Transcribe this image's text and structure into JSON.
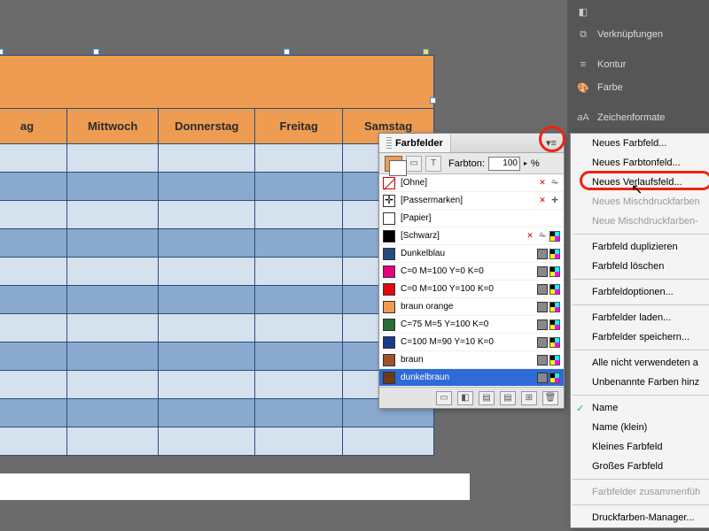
{
  "calendar": {
    "days": [
      "ag",
      "Mittwoch",
      "Donnerstag",
      "Freitag",
      "Samstag"
    ]
  },
  "side_panels": {
    "items": [
      {
        "icon": "layers",
        "label": ""
      },
      {
        "icon": "links",
        "label": "Verknüpfungen"
      },
      {
        "icon": "stroke",
        "label": "Kontur"
      },
      {
        "icon": "color",
        "label": "Farbe"
      },
      {
        "icon": "charstyle",
        "label": "Zeichenformate"
      }
    ]
  },
  "swatches_panel": {
    "title": "Farbfelder",
    "tint_label": "Farbton:",
    "tint_value": "100",
    "tint_unit": "%",
    "rows": [
      {
        "chip": "none",
        "name": "[Ohne]",
        "icons": [
          "x",
          "lock"
        ]
      },
      {
        "chip": "reg",
        "name": "[Passermarken]",
        "icons": [
          "x",
          "reg"
        ]
      },
      {
        "chip": "#ffffff",
        "name": "[Papier]",
        "icons": []
      },
      {
        "chip": "#000000",
        "name": "[Schwarz]",
        "icons": [
          "x",
          "lock",
          "cmyk"
        ]
      },
      {
        "chip": "#284b7e",
        "name": "Dunkelblau",
        "icons": [
          "gray",
          "cmyk"
        ]
      },
      {
        "chip": "#e6007e",
        "name": "C=0 M=100 Y=0 K=0",
        "icons": [
          "gray",
          "cmyk"
        ]
      },
      {
        "chip": "#e30613",
        "name": "C=0 M=100 Y=100 K=0",
        "icons": [
          "gray",
          "cmyk"
        ]
      },
      {
        "chip": "#ed9c52",
        "name": "braun orange",
        "icons": [
          "gray",
          "cmyk"
        ]
      },
      {
        "chip": "#2a6c3a",
        "name": "C=75 M=5 Y=100 K=0",
        "icons": [
          "gray",
          "cmyk"
        ]
      },
      {
        "chip": "#1b3a8a",
        "name": "C=100 M=90 Y=10 K=0",
        "icons": [
          "gray",
          "cmyk"
        ]
      },
      {
        "chip": "#a0522d",
        "name": "braun",
        "icons": [
          "gray",
          "cmyk"
        ]
      },
      {
        "chip": "#6b3a18",
        "name": "dunkelbraun",
        "icons": [
          "gray",
          "cmyk"
        ],
        "selected": true
      }
    ]
  },
  "flyout": {
    "items": [
      {
        "label": "Neues Farbfeld..."
      },
      {
        "label": "Neues Farbtonfeld..."
      },
      {
        "label": "Neues Verlaufsfeld...",
        "highlighted": true
      },
      {
        "label": "Neues Mischdruckfarben",
        "disabled": true
      },
      {
        "label": "Neue Mischdruckfarben-",
        "disabled": true
      },
      {
        "sep": true
      },
      {
        "label": "Farbfeld duplizieren"
      },
      {
        "label": "Farbfeld löschen"
      },
      {
        "sep": true
      },
      {
        "label": "Farbfeldoptionen..."
      },
      {
        "sep": true
      },
      {
        "label": "Farbfelder laden..."
      },
      {
        "label": "Farbfelder speichern..."
      },
      {
        "sep": true
      },
      {
        "label": "Alle nicht verwendeten a"
      },
      {
        "label": "Unbenannte Farben hinz"
      },
      {
        "sep": true
      },
      {
        "label": "Name",
        "checked": true
      },
      {
        "label": "Name (klein)"
      },
      {
        "label": "Kleines Farbfeld"
      },
      {
        "label": "Großes Farbfeld"
      },
      {
        "sep": true
      },
      {
        "label": "Farbfelder zusammenfüh",
        "disabled": true
      },
      {
        "sep": true
      },
      {
        "label": "Druckfarben-Manager..."
      }
    ]
  }
}
